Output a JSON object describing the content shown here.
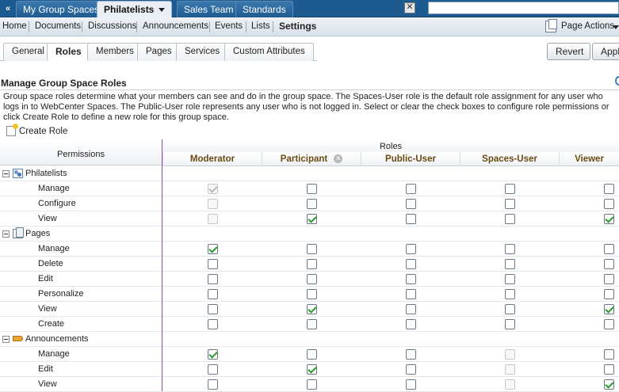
{
  "top_tabs": [
    {
      "label": "My Group Spaces",
      "active": false
    },
    {
      "label": "Philatelists",
      "active": true
    },
    {
      "label": "Sales Team",
      "active": false
    },
    {
      "label": "Standards",
      "active": false
    }
  ],
  "top_arrow": "«",
  "close_label": "✕",
  "nav": {
    "items": [
      "Home",
      "Documents",
      "Discussions",
      "Announcements",
      "Events",
      "Lists",
      "Settings"
    ],
    "page_actions": "Page Actions"
  },
  "sub_tabs": [
    "General",
    "Roles",
    "Members",
    "Pages",
    "Services",
    "Custom Attributes"
  ],
  "buttons": {
    "revert": "Revert",
    "apply": "Apply"
  },
  "section": {
    "title": "Manage Group Space Roles",
    "description": "Group space roles determine what your members can see and do in the group space. The Spaces-User role is the default role assignment for any user who logs in to WebCenter Spaces. The Public-User role represents any user who is not logged in. Select or clear the check boxes to configure role permissions or click Create Role to define a new role for this group space.",
    "create_role": "Create Role"
  },
  "table": {
    "permissions_header": "Permissions",
    "roles_header": "Roles",
    "roles": [
      "Moderator",
      "Participant",
      "Public-User",
      "Spaces-User",
      "Viewer"
    ],
    "groups": [
      {
        "name": "Philatelists",
        "icon": "group-space-icon",
        "permissions": [
          {
            "name": "Manage",
            "checked": [
              true,
              false,
              false,
              false,
              false
            ],
            "disabled": [
              true,
              false,
              false,
              false,
              false
            ]
          },
          {
            "name": "Configure",
            "checked": [
              false,
              false,
              false,
              false,
              false
            ],
            "disabled": [
              true,
              false,
              false,
              false,
              false
            ]
          },
          {
            "name": "View",
            "checked": [
              false,
              true,
              false,
              false,
              true
            ],
            "disabled": [
              true,
              false,
              false,
              false,
              false
            ]
          }
        ]
      },
      {
        "name": "Pages",
        "icon": "pages-icon",
        "permissions": [
          {
            "name": "Manage",
            "checked": [
              true,
              false,
              false,
              false,
              false
            ],
            "disabled": [
              false,
              false,
              false,
              false,
              false
            ]
          },
          {
            "name": "Delete",
            "checked": [
              false,
              false,
              false,
              false,
              false
            ],
            "disabled": [
              false,
              false,
              false,
              false,
              false
            ]
          },
          {
            "name": "Edit",
            "checked": [
              false,
              false,
              false,
              false,
              false
            ],
            "disabled": [
              false,
              false,
              false,
              false,
              false
            ]
          },
          {
            "name": "Personalize",
            "checked": [
              false,
              false,
              false,
              false,
              false
            ],
            "disabled": [
              false,
              false,
              false,
              false,
              false
            ]
          },
          {
            "name": "View",
            "checked": [
              false,
              true,
              false,
              false,
              true
            ],
            "disabled": [
              false,
              false,
              false,
              false,
              false
            ]
          },
          {
            "name": "Create",
            "checked": [
              false,
              false,
              false,
              false,
              false
            ],
            "disabled": [
              false,
              false,
              false,
              false,
              false
            ]
          }
        ]
      },
      {
        "name": "Announcements",
        "icon": "announcements-icon",
        "permissions": [
          {
            "name": "Manage",
            "checked": [
              true,
              false,
              false,
              false,
              false
            ],
            "disabled": [
              false,
              false,
              false,
              true,
              false
            ]
          },
          {
            "name": "Edit",
            "checked": [
              false,
              true,
              false,
              false,
              false
            ],
            "disabled": [
              false,
              false,
              false,
              true,
              false
            ]
          },
          {
            "name": "View",
            "checked": [
              false,
              false,
              false,
              false,
              true
            ],
            "disabled": [
              false,
              false,
              false,
              true,
              false
            ]
          }
        ]
      }
    ]
  }
}
